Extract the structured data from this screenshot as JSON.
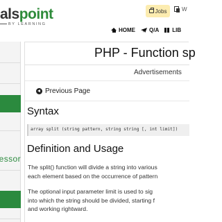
{
  "header": {
    "logo_part1": "als",
    "logo_part2": "point",
    "logo_tagline": "BY LEARNING",
    "jobs_label": "Jobs",
    "w_label": "W",
    "nav": [
      {
        "label": "HOME",
        "icon": "home-icon"
      },
      {
        "label": "Q/A",
        "icon": "qa-icon"
      },
      {
        "label": "LIB",
        "icon": "library-icon"
      }
    ]
  },
  "sidebar": {
    "partial_label": "essor"
  },
  "main": {
    "page_title": "PHP - Function sp",
    "ads_label": "Advertisements",
    "prev_label": "Previous Page",
    "syntax_heading": "Syntax",
    "code": "array split (string pattern, string string [, int limit])",
    "def_heading": "Definition and Usage",
    "para1": [
      "The split() function will divide a string into various",
      "each element based on the occurrence of pattern"
    ],
    "para2": [
      "The optional input parameter limit is used to sig",
      "into which the string should be divided, starting f",
      "and working rightward."
    ]
  },
  "colors": {
    "brand_green": "#2b8a3e",
    "jobs_bg": "#fcecb0"
  }
}
